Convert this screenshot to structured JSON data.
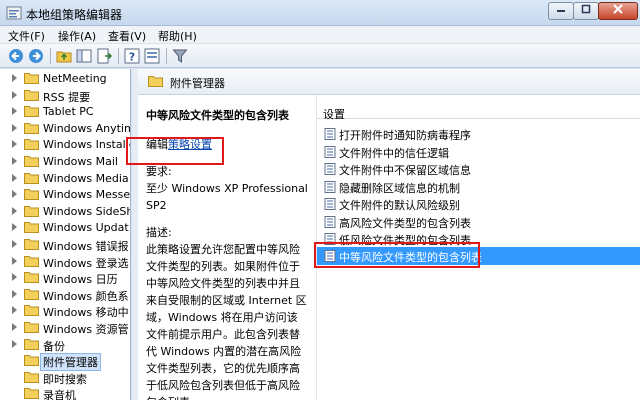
{
  "window": {
    "title": "本地组策略编辑器"
  },
  "menu": [
    {
      "label": "文件(F)"
    },
    {
      "label": "操作(A)"
    },
    {
      "label": "查看(V)"
    },
    {
      "label": "帮助(H)"
    }
  ],
  "tree": {
    "items": [
      {
        "label": "NetMeeting",
        "expandable": true
      },
      {
        "label": "RSS 提要",
        "expandable": true
      },
      {
        "label": "Tablet PC",
        "expandable": true
      },
      {
        "label": "Windows Anytim",
        "expandable": true
      },
      {
        "label": "Windows Installe",
        "expandable": true
      },
      {
        "label": "Windows Mail",
        "expandable": true
      },
      {
        "label": "Windows Media",
        "expandable": true
      },
      {
        "label": "Windows Messe",
        "expandable": true
      },
      {
        "label": "Windows SideSh",
        "expandable": true
      },
      {
        "label": "Windows Updat",
        "expandable": true
      },
      {
        "label": "Windows 错误报",
        "expandable": true
      },
      {
        "label": "Windows 登录选",
        "expandable": true
      },
      {
        "label": "Windows 日历",
        "expandable": true
      },
      {
        "label": "Windows 颜色系",
        "expandable": true
      },
      {
        "label": "Windows 移动中",
        "expandable": true
      },
      {
        "label": "Windows 资源管",
        "expandable": true
      },
      {
        "label": "备份",
        "expandable": true
      },
      {
        "label": "附件管理器",
        "expandable": false,
        "selected": true
      },
      {
        "label": "即时搜索",
        "expandable": false
      },
      {
        "label": "录音机",
        "expandable": false
      }
    ]
  },
  "header": {
    "title": "附件管理器"
  },
  "description": {
    "title": "中等风险文件类型的包含列表",
    "edit_prefix": "编辑",
    "edit_link": "策略设置",
    "requirements_label": "要求:",
    "requirements_text": "至少 Windows XP Professional SP2",
    "desc_label": "描述:",
    "desc_text": "此策略设置允许您配置中等风险文件类型的列表。如果附件位于中等风险文件类型的列表中并且来自受限制的区域或 Internet 区域，Windows 将在用户访问该文件前提示用户。此包含列表替代 Windows 内置的潜在高风险文件类型列表，它的优先顺序高于低风险包含列表但低于高风险包含列表"
  },
  "list": {
    "column_header": "设置",
    "items": [
      {
        "label": "打开附件时通知防病毒程序"
      },
      {
        "label": "文件附件中的信任逻辑"
      },
      {
        "label": "文件附件中不保留区域信息"
      },
      {
        "label": "隐藏删除区域信息的机制"
      },
      {
        "label": "文件附件的默认风险级别"
      },
      {
        "label": "高风险文件类型的包含列表"
      },
      {
        "label": "低风险文件类型的包含列表"
      },
      {
        "label": "中等风险文件类型的包含列表",
        "selected": true
      }
    ]
  },
  "colors": {
    "selection": "#3399ff",
    "highlight_box": "#e01818",
    "link": "#0645ad"
  }
}
